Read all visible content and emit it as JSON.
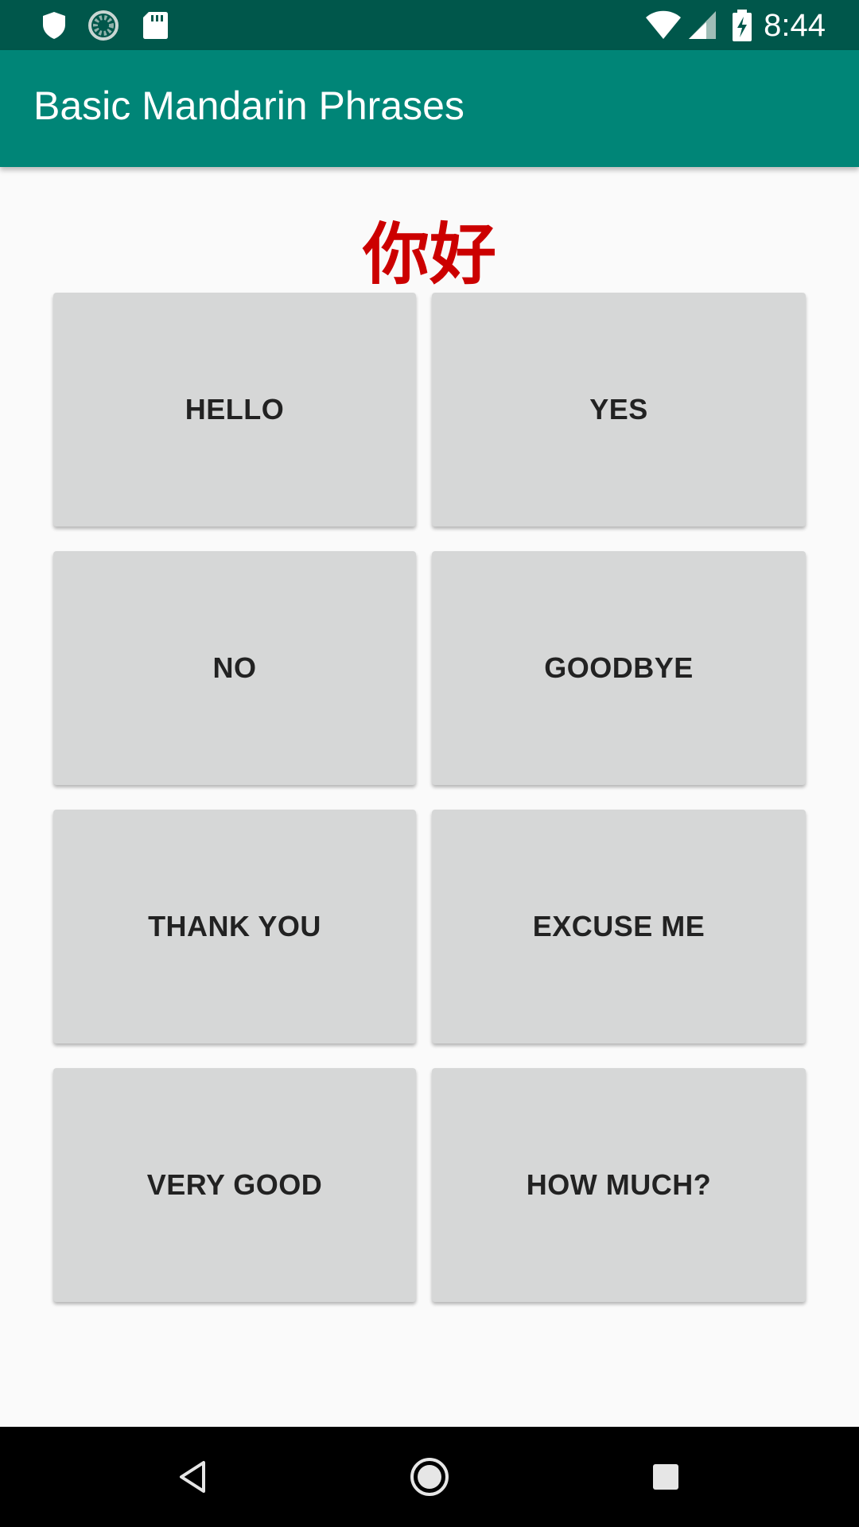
{
  "status_bar": {
    "time": "8:44",
    "icons": [
      "shield-icon",
      "sync-progress-icon",
      "sd-card-icon",
      "wifi-icon",
      "cell-signal-icon",
      "battery-charging-icon"
    ],
    "background": "#00574b"
  },
  "app_bar": {
    "title": "Basic Mandarin Phrases",
    "background": "#008577"
  },
  "main": {
    "phrase_display": "你好",
    "phrase_color": "#cc0000",
    "buttons": [
      {
        "label": "HELLO"
      },
      {
        "label": "YES"
      },
      {
        "label": "NO"
      },
      {
        "label": "GOODBYE"
      },
      {
        "label": "THANK YOU"
      },
      {
        "label": "EXCUSE ME"
      },
      {
        "label": "VERY GOOD"
      },
      {
        "label": "HOW MUCH?"
      }
    ],
    "button_color": "#d6d7d7"
  },
  "nav_bar": {
    "icons": [
      "back-icon",
      "home-icon",
      "recents-icon"
    ]
  }
}
